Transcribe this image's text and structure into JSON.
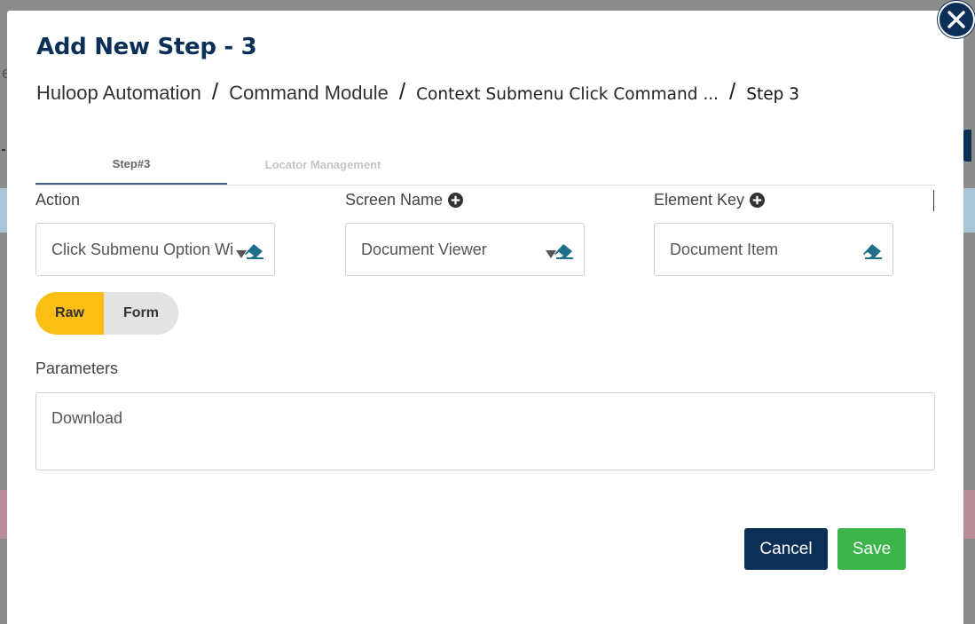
{
  "background": {
    "fragment_text": "e"
  },
  "modal": {
    "title": "Add New Step - 3",
    "breadcrumb": [
      {
        "label": "Huloop Automation"
      },
      {
        "label": "Command Module"
      },
      {
        "label": "Context Submenu Click Command ..."
      },
      {
        "label": "Step 3"
      }
    ],
    "separator": "/",
    "tabs": [
      {
        "label": "Step#3",
        "active": true
      },
      {
        "label": "Locator Management",
        "active": false
      }
    ],
    "fields": {
      "action": {
        "label": "Action",
        "value": "Click Submenu Option With Text"
      },
      "screen_name": {
        "label": "Screen Name",
        "value": "Document Viewer"
      },
      "element_key": {
        "label": "Element Key",
        "value": "Document Item"
      }
    },
    "mode_toggle": {
      "options": [
        "Raw",
        "Form"
      ],
      "selected": "Raw"
    },
    "parameters": {
      "label": "Parameters",
      "value": "Download"
    },
    "buttons": {
      "cancel": "Cancel",
      "save": "Save"
    }
  },
  "colors": {
    "primary": "#0b2f57",
    "accent_yellow": "#fbbe14",
    "success": "#3bb54a",
    "eraser": "#1f6f8b"
  },
  "icons": {
    "close": "close-icon",
    "add": "plus-circle-icon",
    "clear": "eraser-icon",
    "dropdown": "caret-down-icon"
  }
}
